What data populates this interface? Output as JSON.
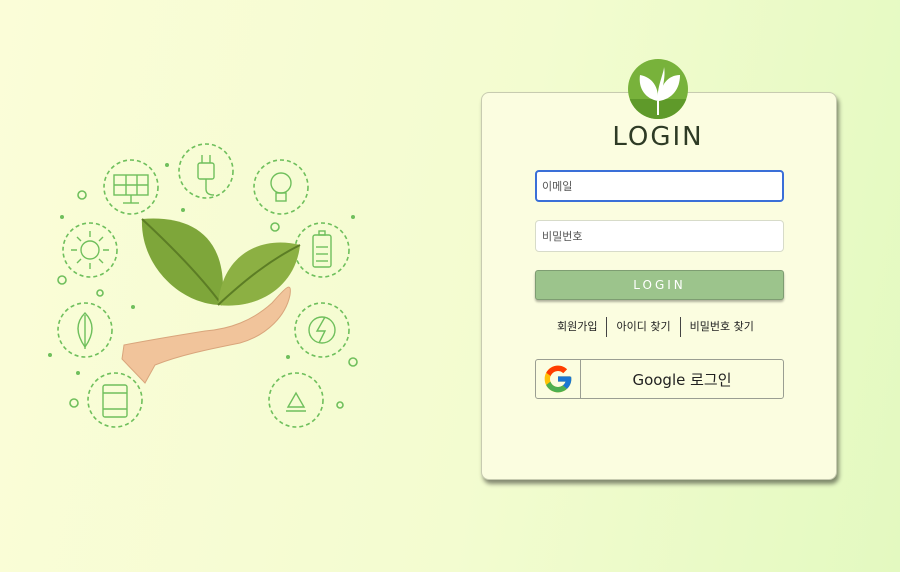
{
  "login": {
    "title": "LOGIN",
    "email_placeholder": "이메일",
    "password_placeholder": "비밀번호",
    "submit_label": "LOGIN",
    "links": [
      "회원가입",
      "아이디 찾기",
      "비밀번호 찾기"
    ],
    "google_label": "Google 로그인"
  },
  "colors": {
    "accent_green": "#78b23b",
    "button_green": "#9cc48c",
    "focus_blue": "#3a6fd8"
  },
  "icons": {
    "illustration": "hand-holding-leaves-energy-icons",
    "logo": "leaf-logo-icon",
    "google": "google-g-icon"
  }
}
